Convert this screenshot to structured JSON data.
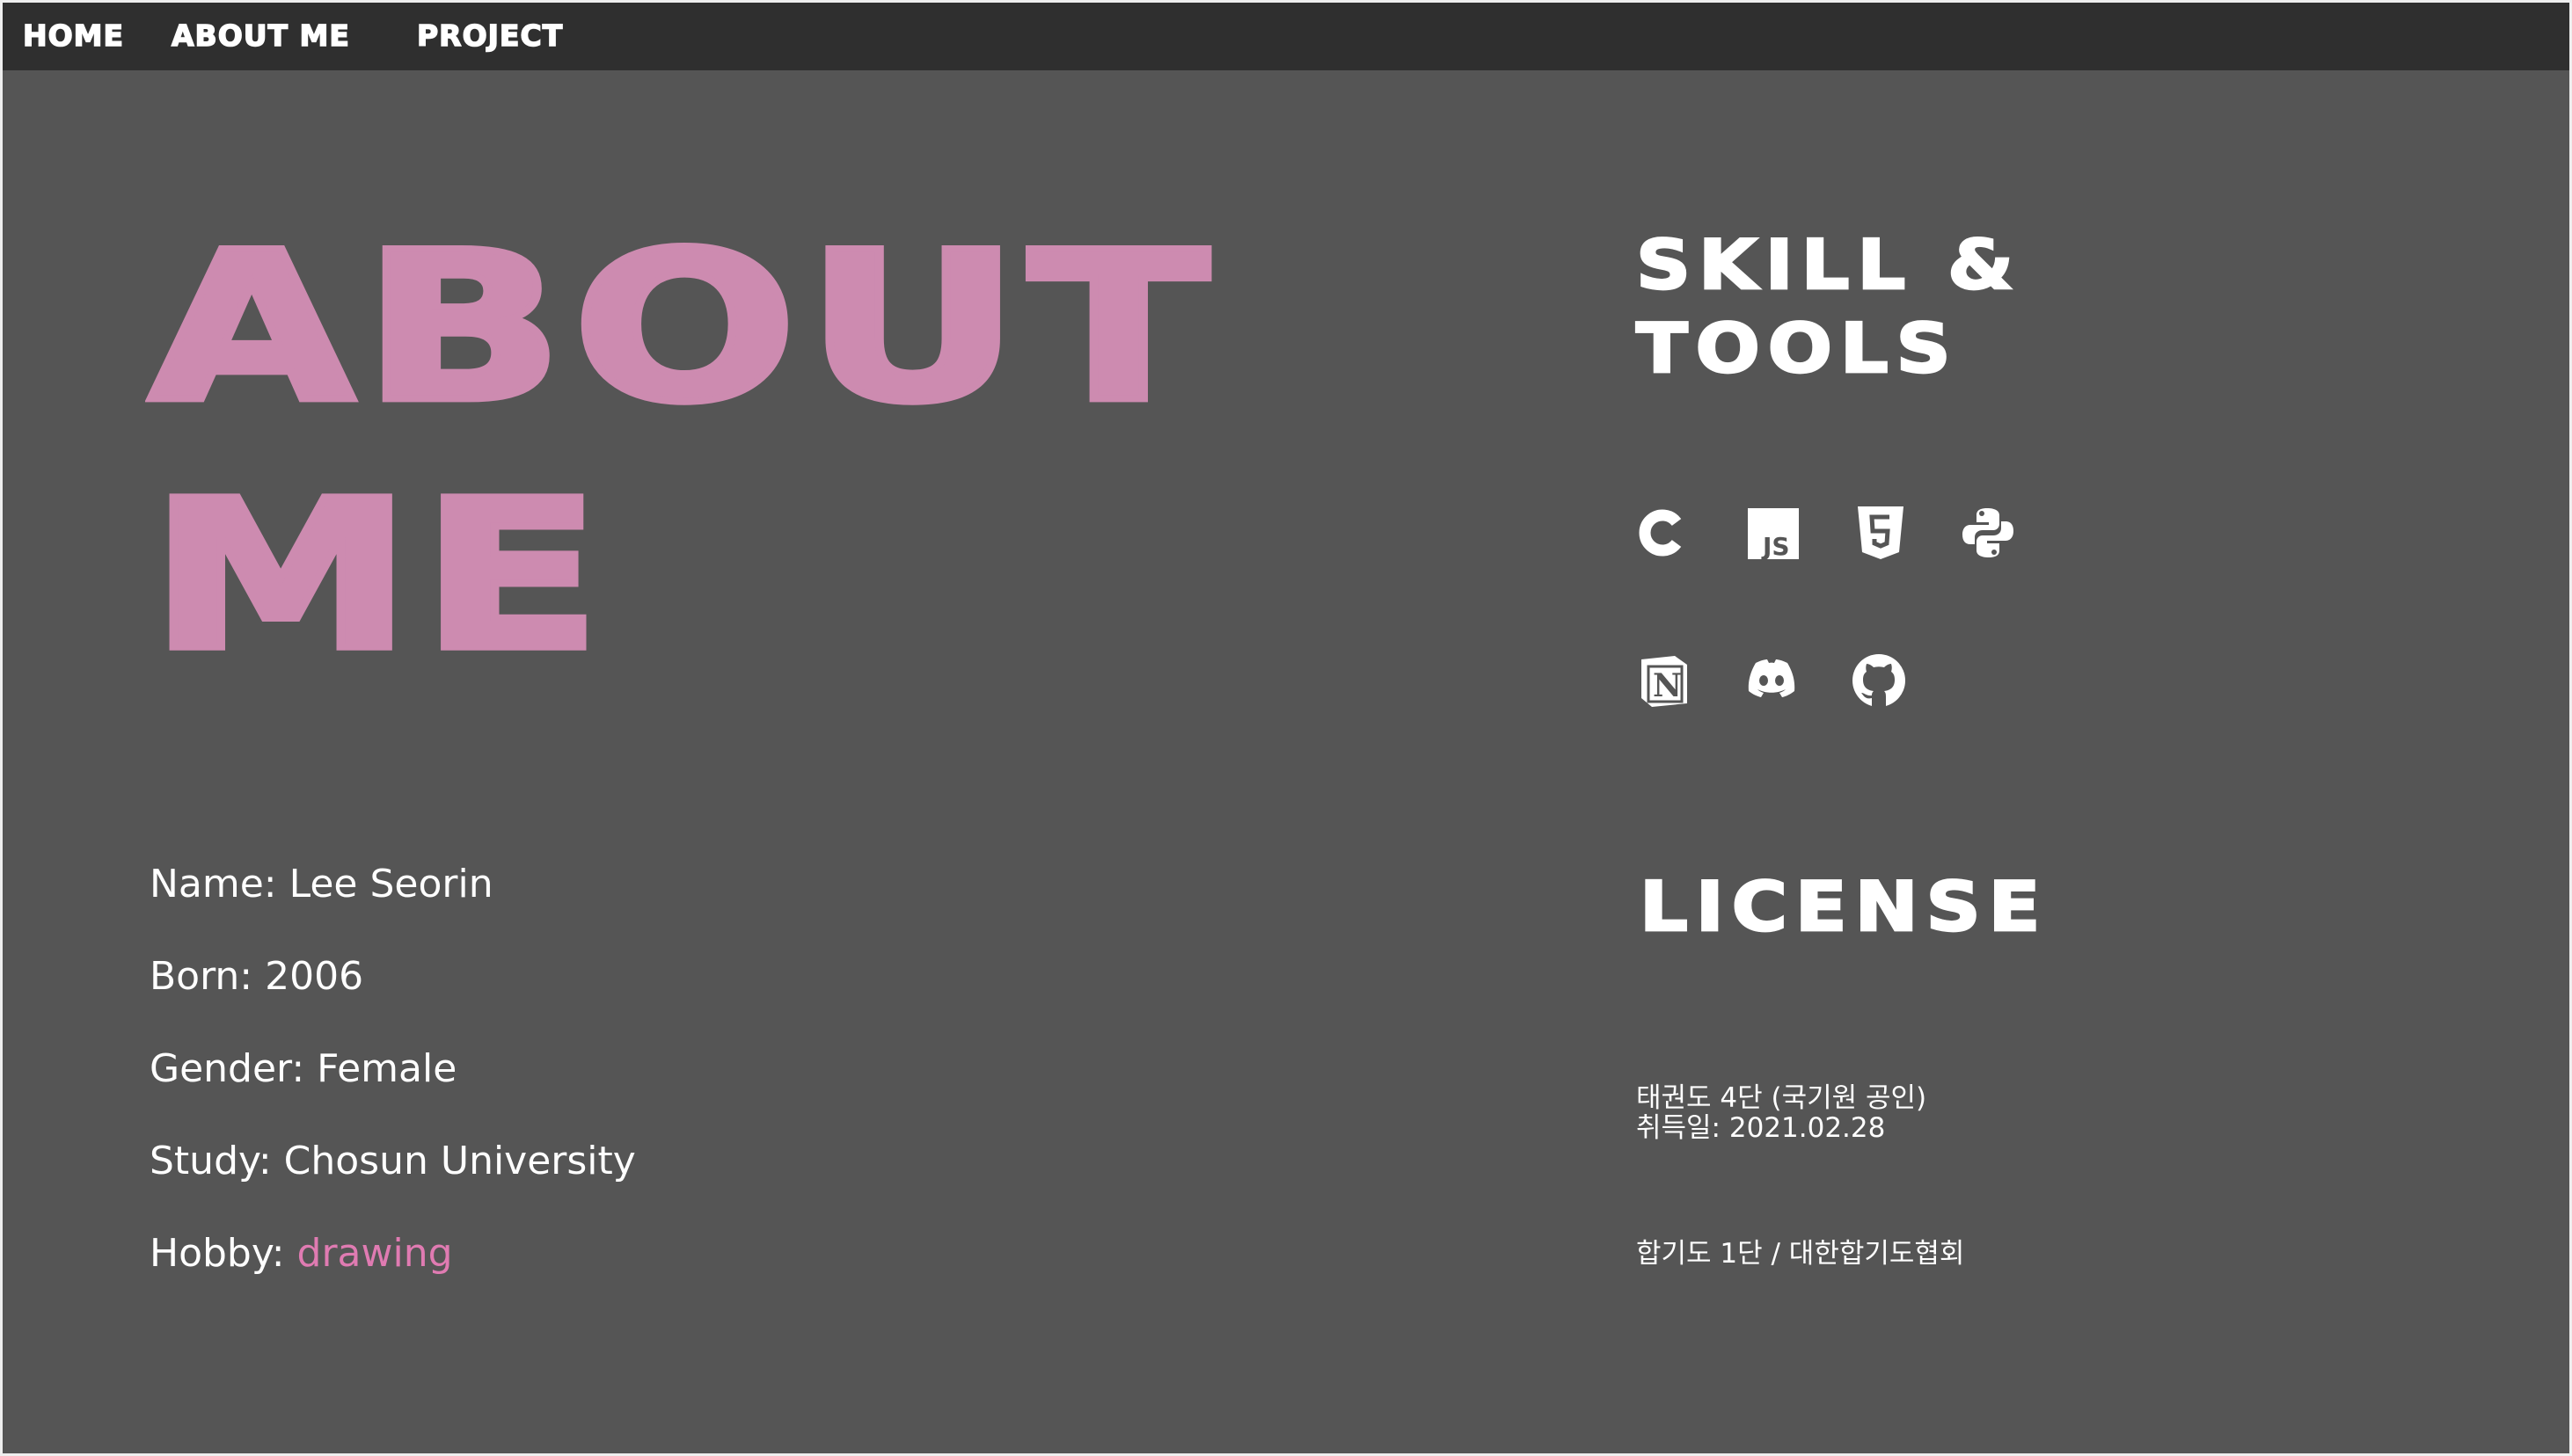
{
  "nav": {
    "items": [
      {
        "label": "HOME"
      },
      {
        "label": "ABOUT ME"
      },
      {
        "label": "PROJECT"
      }
    ]
  },
  "about": {
    "title_line1": "ABOUT",
    "title_line2": "ME",
    "name": "Name: Lee Seorin",
    "born": "Born: 2006",
    "gender": "Gender: Female",
    "study": "Study: Chosun University",
    "hobby_label": "Hobby: ",
    "hobby_value": "drawing"
  },
  "skills": {
    "title_line1": "SKILL &",
    "title_line2": "TOOLS",
    "icons": [
      "c-icon",
      "javascript-icon",
      "html5-icon",
      "python-icon",
      "notion-icon",
      "discord-icon",
      "github-icon"
    ]
  },
  "license": {
    "title": "LICENSE",
    "taekwondo_line1": "태권도 4단 (국기원 공인)",
    "taekwondo_line2": "취득일: 2021.02.28",
    "hapkido": "합기도 1단 / 대한합기도협회"
  },
  "colors": {
    "background": "#555555",
    "navbar": "#2f2f2f",
    "accent_pink": "#cd8bb0",
    "hobby_pink": "#e07bb2",
    "text": "#ffffff"
  }
}
